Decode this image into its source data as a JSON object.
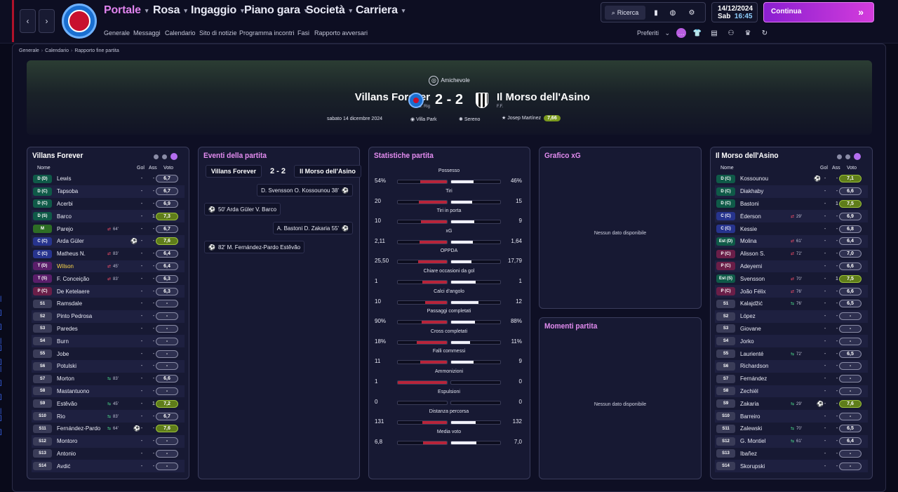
{
  "nav": {
    "back": "‹",
    "forward": "›",
    "items": [
      {
        "label": "Portale"
      },
      {
        "label": "Rosa"
      },
      {
        "label": "Ingaggio"
      },
      {
        "label": "Piano gara"
      },
      {
        "label": "Società"
      },
      {
        "label": "Carriera"
      }
    ],
    "sub": [
      "Generale",
      "Messaggi",
      "Calendario",
      "Sito di notizie",
      "Programma incontri",
      "Fasi",
      "Rapporto avversari"
    ]
  },
  "toolbar": {
    "search": "Ricerca",
    "date": "14/12/2024",
    "day": "Sab",
    "time": "16:45",
    "continue": "Continua",
    "preferiti": "Preferiti"
  },
  "breadcrumb": [
    "Generale",
    "Calendario",
    "Rapporto fine partita"
  ],
  "match": {
    "competition": "Amichevole",
    "home": "Villans Forever",
    "home_coach": "G. Rig",
    "score": "2 - 2",
    "away": "Il Morso dell'Asino",
    "away_coach": "F.F.",
    "date": "sabato 14 dicembre 2024",
    "stadium": "Villa Park",
    "weather": "Sereno",
    "referee": "Josep Martínez",
    "ref_rating": "7,66"
  },
  "home_panel": {
    "title": "Villans Forever",
    "cols": {
      "name": "Nome",
      "gol": "Gol",
      "ass": "Ass",
      "voto": "Voto"
    },
    "players": [
      {
        "pos": "D (D)",
        "c": "#0f5a48",
        "name": "Lewis",
        "sub": "",
        "g": "-",
        "a": "-",
        "v": "6,7"
      },
      {
        "pos": "D (C)",
        "c": "#0f5a48",
        "name": "Tapsoba",
        "sub": "",
        "g": "-",
        "a": "-",
        "v": "6,7"
      },
      {
        "pos": "D (C)",
        "c": "#0f5a48",
        "name": "Acerbi",
        "sub": "",
        "g": "-",
        "a": "-",
        "v": "6,9"
      },
      {
        "pos": "D (S)",
        "c": "#0f5a48",
        "name": "Barco",
        "sub": "",
        "g": "-",
        "a": "1",
        "v": "7,3",
        "good": true
      },
      {
        "pos": "M",
        "c": "#2e6e25",
        "name": "Parejo",
        "sub": "out",
        "m": "64'",
        "g": "-",
        "a": "-",
        "v": "6,7"
      },
      {
        "pos": "C (C)",
        "c": "#27348e",
        "name": "Arda Güler",
        "sub": "",
        "ball": true,
        "g": "-",
        "a": "-",
        "v": "7,6",
        "good": true
      },
      {
        "pos": "C (C)",
        "c": "#27348e",
        "name": "Matheus N.",
        "sub": "out",
        "m": "83'",
        "g": "-",
        "a": "-",
        "v": "6,4"
      },
      {
        "pos": "T (D)",
        "c": "#5a1e6a",
        "name": "Wilson",
        "hl": true,
        "sub": "out",
        "m": "45'",
        "g": "-",
        "a": "-",
        "v": "6,4"
      },
      {
        "pos": "T (S)",
        "c": "#5a1e6a",
        "name": "F. Conceição",
        "sub": "out",
        "m": "83'",
        "g": "-",
        "a": "-",
        "v": "6,3"
      },
      {
        "pos": "P (C)",
        "c": "#6a1e48",
        "name": "De Ketelaere",
        "sub": "",
        "g": "-",
        "a": "-",
        "v": "6,3"
      },
      {
        "pos": "S1",
        "c": "#3a3c58",
        "name": "Ramsdale",
        "sub": "",
        "g": "-",
        "a": "-",
        "v": "-"
      },
      {
        "pos": "S2",
        "c": "#3a3c58",
        "name": "Pinto Pedrosa",
        "sub": "",
        "g": "-",
        "a": "-",
        "v": "-"
      },
      {
        "pos": "S3",
        "c": "#3a3c58",
        "name": "Paredes",
        "sub": "",
        "g": "-",
        "a": "-",
        "v": "-"
      },
      {
        "pos": "S4",
        "c": "#3a3c58",
        "name": "Burn",
        "sub": "",
        "g": "-",
        "a": "-",
        "v": "-"
      },
      {
        "pos": "S5",
        "c": "#3a3c58",
        "name": "Jobe",
        "sub": "",
        "g": "-",
        "a": "-",
        "v": "-"
      },
      {
        "pos": "S6",
        "c": "#3a3c58",
        "name": "Potulski",
        "sub": "",
        "g": "-",
        "a": "-",
        "v": "-"
      },
      {
        "pos": "S7",
        "c": "#3a3c58",
        "name": "Morton",
        "sub": "in",
        "m": "83'",
        "g": "-",
        "a": "-",
        "v": "6,6"
      },
      {
        "pos": "S8",
        "c": "#3a3c58",
        "name": "Mastantuono",
        "sub": "",
        "g": "-",
        "a": "-",
        "v": "-"
      },
      {
        "pos": "S9",
        "c": "#3a3c58",
        "name": "Estêvão",
        "sub": "in",
        "m": "45'",
        "g": "-",
        "a": "1",
        "v": "7,2",
        "good": true
      },
      {
        "pos": "S10",
        "c": "#3a3c58",
        "name": "Rio",
        "sub": "in",
        "m": "83'",
        "g": "-",
        "a": "-",
        "v": "6,7"
      },
      {
        "pos": "S11",
        "c": "#3a3c58",
        "name": "Fernández-Pardo",
        "sub": "in",
        "m": "64'",
        "ball": true,
        "g": "-",
        "a": "-",
        "v": "7,6",
        "good": true
      },
      {
        "pos": "S12",
        "c": "#3a3c58",
        "name": "Montoro",
        "sub": "",
        "g": "-",
        "a": "-",
        "v": "-"
      },
      {
        "pos": "S13",
        "c": "#3a3c58",
        "name": "Antonio",
        "sub": "",
        "g": "-",
        "a": "-",
        "v": "-"
      },
      {
        "pos": "S14",
        "c": "#3a3c58",
        "name": "Avdić",
        "sub": "",
        "g": "-",
        "a": "-",
        "v": "-"
      }
    ]
  },
  "events": {
    "title": "Eventi della partita",
    "home": "Villans Forever",
    "score": "2 - 2",
    "away": "Il Morso dell'Asino",
    "list": [
      {
        "side": "away",
        "text": "D. Svensson  O. Kossounou  38'"
      },
      {
        "side": "home",
        "text": "50'  Arda Güler  V. Barco"
      },
      {
        "side": "away",
        "text": "A. Bastoni  D. Zakaria  55'"
      },
      {
        "side": "home",
        "text": "82'  M. Fernández-Pardo  Estêvão"
      }
    ]
  },
  "stats": {
    "title": "Statistiche partita",
    "rows": [
      {
        "label": "Possesso",
        "l": "54%",
        "r": "46%",
        "lf": 0.54,
        "rf": 0.46
      },
      {
        "label": "Tiri",
        "l": "20",
        "r": "15",
        "lf": 0.57,
        "rf": 0.43
      },
      {
        "label": "Tiri in porta",
        "l": "10",
        "r": "9",
        "lf": 0.53,
        "rf": 0.47
      },
      {
        "label": "xG",
        "l": "2,11",
        "r": "1,64",
        "lf": 0.56,
        "rf": 0.44
      },
      {
        "label": "OPPDA",
        "l": "25,50",
        "r": "17,79",
        "lf": 0.59,
        "rf": 0.41
      },
      {
        "label": "Chiare occasioni da gol",
        "l": "1",
        "r": "1",
        "lf": 0.5,
        "rf": 0.5
      },
      {
        "label": "Calci d'angolo",
        "l": "10",
        "r": "12",
        "lf": 0.45,
        "rf": 0.55
      },
      {
        "label": "Passaggi completati",
        "l": "90%",
        "r": "88%",
        "lf": 0.51,
        "rf": 0.49
      },
      {
        "label": "Cross completati",
        "l": "18%",
        "r": "11%",
        "lf": 0.62,
        "rf": 0.38
      },
      {
        "label": "Falli commessi",
        "l": "11",
        "r": "9",
        "lf": 0.55,
        "rf": 0.45
      },
      {
        "label": "Ammonizioni",
        "l": "1",
        "r": "0",
        "lf": 1.0,
        "rf": 0.0
      },
      {
        "label": "Espulsioni",
        "l": "0",
        "r": "0",
        "lf": 0.0,
        "rf": 0.0
      },
      {
        "label": "Distanza percorsa",
        "l": "131",
        "r": "132",
        "lf": 0.5,
        "rf": 0.5
      },
      {
        "label": "Media voto",
        "l": "6,8",
        "r": "7,0",
        "lf": 0.49,
        "rf": 0.51
      }
    ]
  },
  "xg": {
    "title": "Grafico xG",
    "empty": "Nessun dato disponibile"
  },
  "moments": {
    "title": "Momenti partita",
    "empty": "Nessun dato disponibile"
  },
  "away_panel": {
    "title": "Il Morso dell'Asino",
    "cols": {
      "name": "Nome",
      "gol": "Gol",
      "ass": "Ass",
      "voto": "Voto"
    },
    "players": [
      {
        "pos": "D (C)",
        "c": "#0f5a48",
        "name": "Kossounou",
        "sub": "",
        "ball": true,
        "g": "-",
        "a": "-",
        "v": "7,1",
        "good": true
      },
      {
        "pos": "D (C)",
        "c": "#0f5a48",
        "name": "Diakhaby",
        "sub": "",
        "g": "-",
        "a": "-",
        "v": "6,6"
      },
      {
        "pos": "D (C)",
        "c": "#0f5a48",
        "name": "Bastoni",
        "sub": "",
        "g": "-",
        "a": "1",
        "v": "7,5",
        "good": true
      },
      {
        "pos": "C (C)",
        "c": "#27348e",
        "name": "Éderson",
        "sub": "out",
        "m": "29'",
        "g": "-",
        "a": "-",
        "v": "6,9"
      },
      {
        "pos": "C (C)",
        "c": "#27348e",
        "name": "Kessie",
        "sub": "",
        "g": "-",
        "a": "-",
        "v": "6,8"
      },
      {
        "pos": "Est (D)",
        "c": "#0f5a48",
        "name": "Molina",
        "sub": "out",
        "m": "61'",
        "g": "-",
        "a": "-",
        "v": "6,4"
      },
      {
        "pos": "P (C)",
        "c": "#6a1e48",
        "name": "Alisson S.",
        "sub": "out",
        "m": "72'",
        "g": "-",
        "a": "-",
        "v": "7,0"
      },
      {
        "pos": "P (C)",
        "c": "#6a1e48",
        "name": "Adeyemi",
        "sub": "",
        "g": "-",
        "a": "-",
        "v": "6,6"
      },
      {
        "pos": "Est (S)",
        "c": "#0f5a48",
        "name": "Svensson",
        "sub": "out",
        "m": "70'",
        "g": "-",
        "a": "1",
        "v": "7,5",
        "good": true
      },
      {
        "pos": "P (C)",
        "c": "#6a1e48",
        "name": "João Félix",
        "sub": "out",
        "m": "76'",
        "g": "-",
        "a": "-",
        "v": "6,6"
      },
      {
        "pos": "S1",
        "c": "#3a3c58",
        "name": "Kalajdžić",
        "sub": "in",
        "m": "76'",
        "g": "-",
        "a": "-",
        "v": "6,5"
      },
      {
        "pos": "S2",
        "c": "#3a3c58",
        "name": "López",
        "sub": "",
        "g": "-",
        "a": "-",
        "v": "-"
      },
      {
        "pos": "S3",
        "c": "#3a3c58",
        "name": "Giovane",
        "sub": "",
        "g": "-",
        "a": "-",
        "v": "-"
      },
      {
        "pos": "S4",
        "c": "#3a3c58",
        "name": "Jorko",
        "sub": "",
        "g": "-",
        "a": "-",
        "v": "-"
      },
      {
        "pos": "S5",
        "c": "#3a3c58",
        "name": "Laurienté",
        "sub": "in",
        "m": "72'",
        "g": "-",
        "a": "-",
        "v": "6,5"
      },
      {
        "pos": "S6",
        "c": "#3a3c58",
        "name": "Richardson",
        "sub": "",
        "g": "-",
        "a": "-",
        "v": "-"
      },
      {
        "pos": "S7",
        "c": "#3a3c58",
        "name": "Fernández",
        "sub": "",
        "g": "-",
        "a": "-",
        "v": "-"
      },
      {
        "pos": "S8",
        "c": "#3a3c58",
        "name": "Zechiël",
        "sub": "",
        "g": "-",
        "a": "-",
        "v": "-"
      },
      {
        "pos": "S9",
        "c": "#3a3c58",
        "name": "Zakaria",
        "sub": "in",
        "m": "29'",
        "ball": true,
        "g": "-",
        "a": "-",
        "v": "7,6",
        "good": true
      },
      {
        "pos": "S10",
        "c": "#3a3c58",
        "name": "Barreiro",
        "sub": "",
        "g": "-",
        "a": "-",
        "v": "-"
      },
      {
        "pos": "S11",
        "c": "#3a3c58",
        "name": "Zalewski",
        "sub": "in",
        "m": "70'",
        "g": "-",
        "a": "-",
        "v": "6,5"
      },
      {
        "pos": "S12",
        "c": "#3a3c58",
        "name": "G. Montiel",
        "sub": "in",
        "m": "61'",
        "g": "-",
        "a": "-",
        "v": "6,4"
      },
      {
        "pos": "S13",
        "c": "#3a3c58",
        "name": "Ibañez",
        "sub": "",
        "g": "-",
        "a": "-",
        "v": "-"
      },
      {
        "pos": "S14",
        "c": "#3a3c58",
        "name": "Skorupski",
        "sub": "",
        "g": "-",
        "a": "-",
        "v": "-"
      }
    ]
  }
}
